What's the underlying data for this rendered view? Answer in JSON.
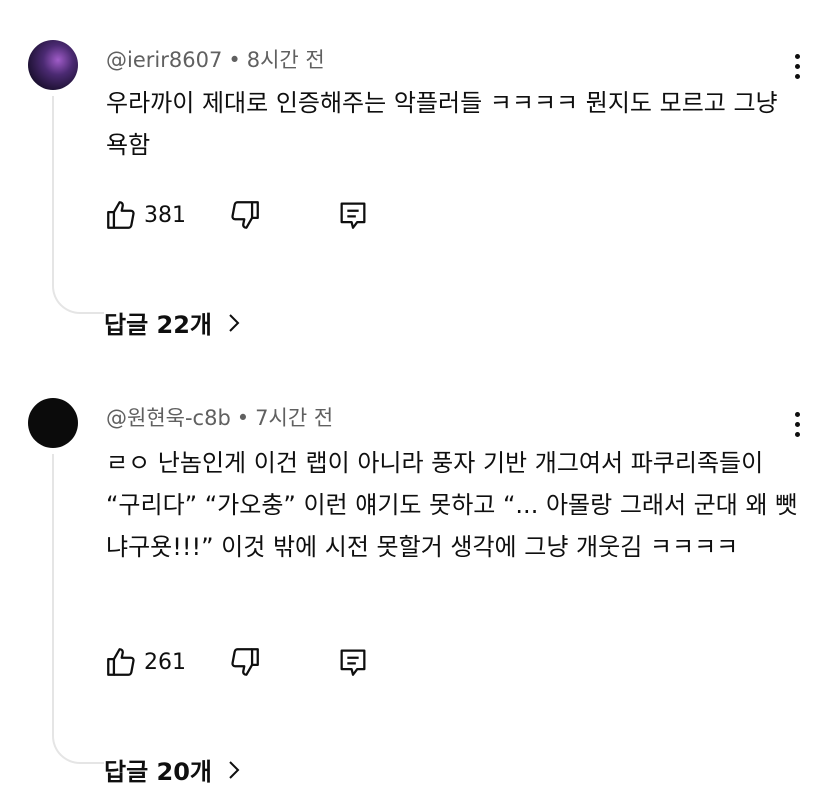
{
  "comments": [
    {
      "author": "@ierir8607",
      "time": "8시간 전",
      "text": "우라까이 제대로 인증해주는 악플러들 ㅋㅋㅋㅋ 뭔지도 모르고 그냥 욕함",
      "likes": "381",
      "replies": "답글 22개"
    },
    {
      "author": "@원현욱-c8b",
      "time": "7시간 전",
      "text": "ㄹㅇ 난놈인게 이건 랩이 아니라 풍자 기반 개그여서 파쿠리족들이 “구리다” “가오충” 이런 얘기도 못하고 “... 아몰랑 그래서 군대 왜 뺏냐구욧!!!” 이것 밖에 시전 못할거 생각에 그냥 개웃김 ㅋㅋㅋㅋ",
      "likes": "261",
      "replies": "답글 20개"
    }
  ],
  "meta_separator": "•",
  "icons": [
    "thumbs-up-icon",
    "thumbs-down-icon",
    "reply-icon",
    "more-vert-icon",
    "chevron-right-icon"
  ]
}
